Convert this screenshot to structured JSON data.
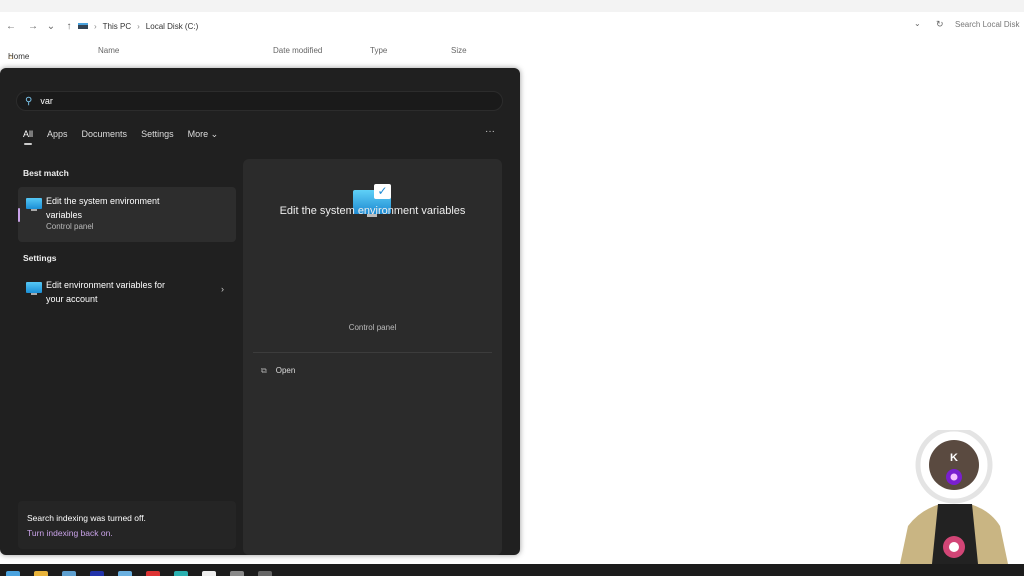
{
  "explorer": {
    "breadcrumb": [
      "This PC",
      "Local Disk (C:)"
    ],
    "search_placeholder": "Search Local Disk",
    "sidebar_home": "Home",
    "columns": [
      "Name",
      "Date modified",
      "Type",
      "Size"
    ]
  },
  "start": {
    "query": "var",
    "tabs": [
      "All",
      "Apps",
      "Documents",
      "Settings",
      "More"
    ],
    "more_chevron": "⌄",
    "more_menu": "···",
    "best_match_heading": "Best match",
    "best_match": {
      "title": "Edit the system environment variables",
      "subtitle": "Control panel"
    },
    "settings_heading": "Settings",
    "settings_item": {
      "title": "Edit environment variables for your account"
    },
    "preview": {
      "title": "Edit the system environment variables",
      "subtitle": "Control panel",
      "action": "Open"
    },
    "indexing": {
      "message": "Search indexing was turned off.",
      "link": "Turn indexing back on."
    }
  },
  "avatar_letter": "K",
  "colors": {
    "accent_link": "#c9a2e8",
    "menu_bg": "#202020"
  }
}
